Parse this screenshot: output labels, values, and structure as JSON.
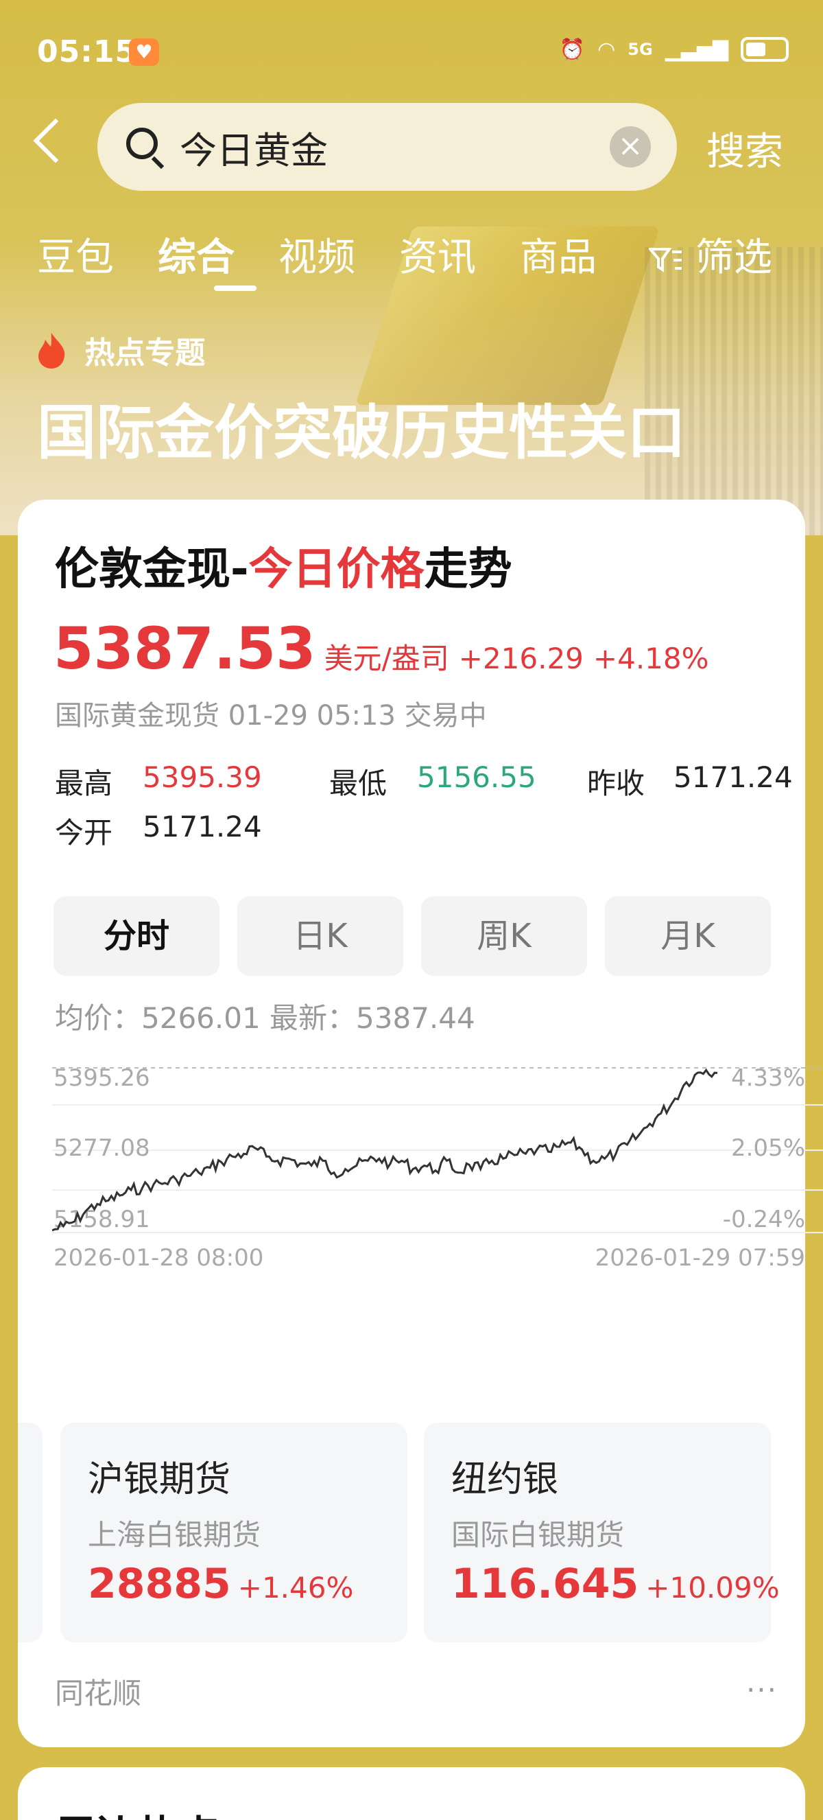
{
  "status_bar": {
    "time": "05:15",
    "network": "5G"
  },
  "search": {
    "query": "今日黄金",
    "button": "搜索"
  },
  "tabs": [
    {
      "label": "豆包",
      "active": false
    },
    {
      "label": "综合",
      "active": true
    },
    {
      "label": "视频",
      "active": false
    },
    {
      "label": "资讯",
      "active": false
    },
    {
      "label": "商品",
      "active": false
    },
    {
      "label": "筛选",
      "active": false
    }
  ],
  "hot_topic": {
    "tag": "热点专题",
    "title": "国际金价突破历史性关口"
  },
  "card": {
    "title_prefix": "伦敦金现-",
    "title_highlight": "今日价格",
    "title_suffix": "走势",
    "price": "5387.53",
    "unit": "美元/盎司",
    "change": "+216.29",
    "change_pct": "+4.18%",
    "subinfo": "国际黄金现货 01-29 05:13 交易中",
    "stats": {
      "high_label": "最高",
      "high": "5395.39",
      "low_label": "最低",
      "low": "5156.55",
      "prev_close_label": "昨收",
      "prev_close": "5171.24",
      "open_label": "今开",
      "open": "5171.24"
    },
    "ktabs": [
      "分时",
      "日K",
      "周K",
      "月K"
    ],
    "avg_line": "均价：5266.01   最新：5387.44",
    "sub_cards": [
      {
        "name": "沪银期货",
        "desc": "上海白银期货",
        "price": "28885",
        "pct": "+1.46%"
      },
      {
        "name": "纽约银",
        "desc": "国际白银期货",
        "price": "116.645",
        "pct": "+10.09%"
      }
    ],
    "source": "同花顺",
    "more": "···"
  },
  "next_card": {
    "title": "周边热点"
  },
  "chart_data": {
    "type": "line",
    "y_ticks": [
      "5395.26",
      "5277.08",
      "5158.91"
    ],
    "y_pct_ticks": [
      "4.33%",
      "2.05%",
      "-0.24%"
    ],
    "x_labels": [
      "2026-01-28 08:00",
      "2026-01-29 07:59"
    ],
    "ylim": [
      5158.91,
      5395.26
    ],
    "series": [
      {
        "values": [
          5162,
          5168,
          5175,
          5190,
          5200,
          5205,
          5212,
          5220,
          5223,
          5228,
          5230,
          5235,
          5240,
          5245,
          5252,
          5260,
          5268,
          5272,
          5280,
          5268,
          5262,
          5265,
          5258,
          5255,
          5262,
          5245,
          5250,
          5255,
          5262,
          5265,
          5258,
          5262,
          5250,
          5255,
          5248,
          5262,
          5245,
          5256,
          5250,
          5262,
          5265,
          5270,
          5272,
          5278,
          5275,
          5282,
          5288,
          5278,
          5262,
          5265,
          5272,
          5285,
          5298,
          5315,
          5330,
          5345,
          5370,
          5385,
          5392,
          5388
        ]
      }
    ]
  }
}
